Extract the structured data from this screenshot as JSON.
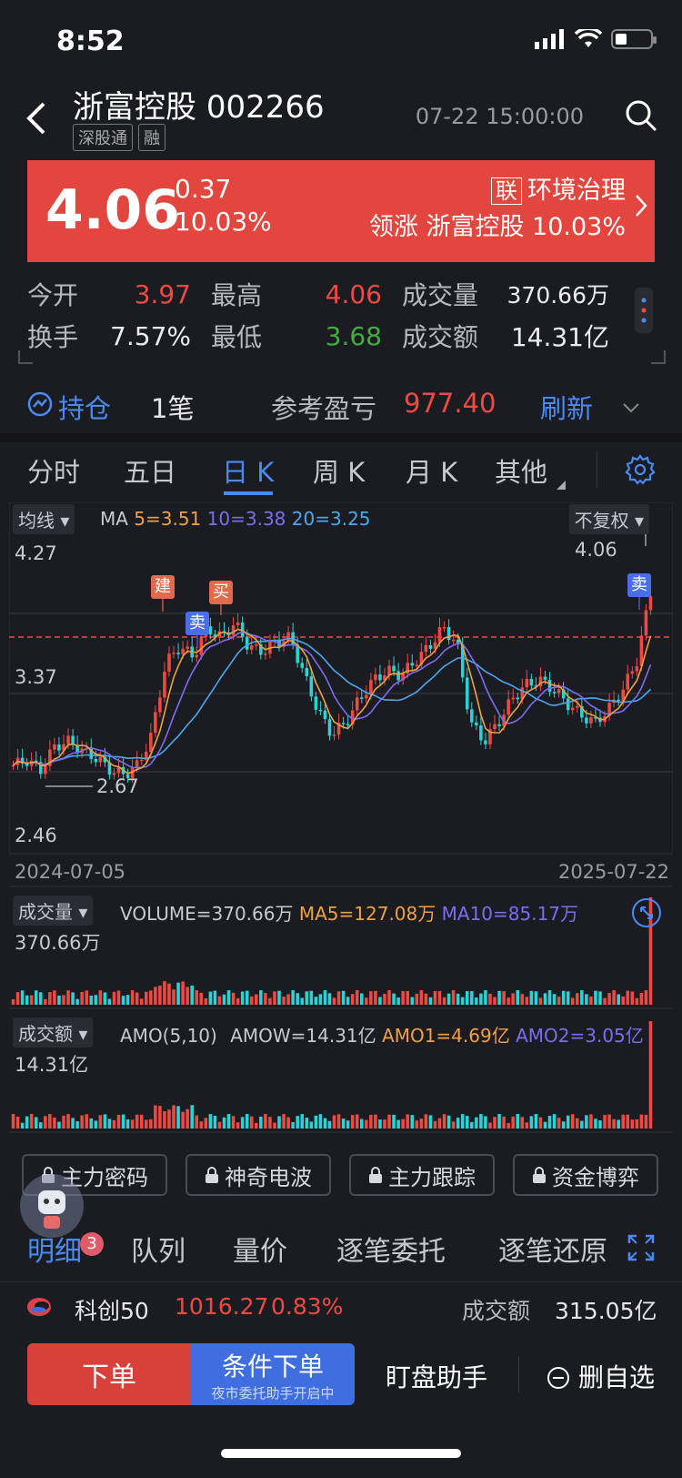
{
  "status": {
    "time": "8:52"
  },
  "header": {
    "name": "浙富控股",
    "code": "002266",
    "tags": [
      "深股通",
      "融"
    ],
    "datetime": "07-22 15:00:00"
  },
  "quote": {
    "price": "4.06",
    "change": "0.37",
    "change_pct": "10.03%",
    "sector_tag": "联",
    "sector": "环境治理",
    "leader_label": "领涨",
    "leader_name": "浙富控股",
    "leader_pct": "10.03%"
  },
  "stats": {
    "open_label": "今开",
    "open": "3.97",
    "high_label": "最高",
    "high": "4.06",
    "vol_label": "成交量",
    "vol": "370.66万",
    "turnover_label": "换手",
    "turnover": "7.57%",
    "low_label": "最低",
    "low": "3.68",
    "amount_label": "成交额",
    "amount": "14.31亿"
  },
  "holding": {
    "label": "持仓",
    "count": "1笔",
    "pnl_label": "参考盈亏",
    "pnl": "977.40",
    "refresh": "刷新"
  },
  "tabs": [
    "分时",
    "五日",
    "日 K",
    "周 K",
    "月 K",
    "其他"
  ],
  "active_tab": 2,
  "kline": {
    "indicator_pill": "均线",
    "ma_label": "MA",
    "ma5": "5=3.51",
    "ma10": "10=3.38",
    "ma20": "20=3.25",
    "adjust_pill": "不复权",
    "y_top": "4.27",
    "y_mid": "3.37",
    "y_bottom": "2.46",
    "max_label": "4.06",
    "min_label": "2.67",
    "date_start": "2024-07-05",
    "date_end": "2025-07-22",
    "markers": [
      "建",
      "卖",
      "买",
      "卖"
    ],
    "colors": {
      "up": "#ef4a42",
      "down": "#2ad3d6",
      "ma5": "#f0a040",
      "ma10": "#7c6cf0",
      "ma20": "#4aa8f0"
    }
  },
  "volume": {
    "pill": "成交量",
    "volume": "VOLUME=370.66万",
    "ma5": "MA5=127.08万",
    "ma10": "MA10=85.17万",
    "max_label": "370.66万"
  },
  "amount": {
    "pill": "成交额",
    "label": "AMO(5,10)",
    "amow": "AMOW=14.31亿",
    "amo1": "AMO1=4.69亿",
    "amo2": "AMO2=3.05亿",
    "max_label": "14.31亿"
  },
  "locks": [
    "主力密码",
    "神奇电波",
    "主力跟踪",
    "资金博弈"
  ],
  "detail_tabs": [
    "明细",
    "队列",
    "量价",
    "逐笔委托",
    "逐笔还原"
  ],
  "detail_badge": "3",
  "index_bar": {
    "name": "科创50",
    "value": "1016.27",
    "pct": "0.83%",
    "amount_label": "成交额",
    "amount": "315.05亿"
  },
  "bottom": {
    "order": "下单",
    "cond_order": "条件下单",
    "cond_sub": "夜市委托助手开启中",
    "assist": "盯盘助手",
    "del_fav": "删自选"
  }
}
